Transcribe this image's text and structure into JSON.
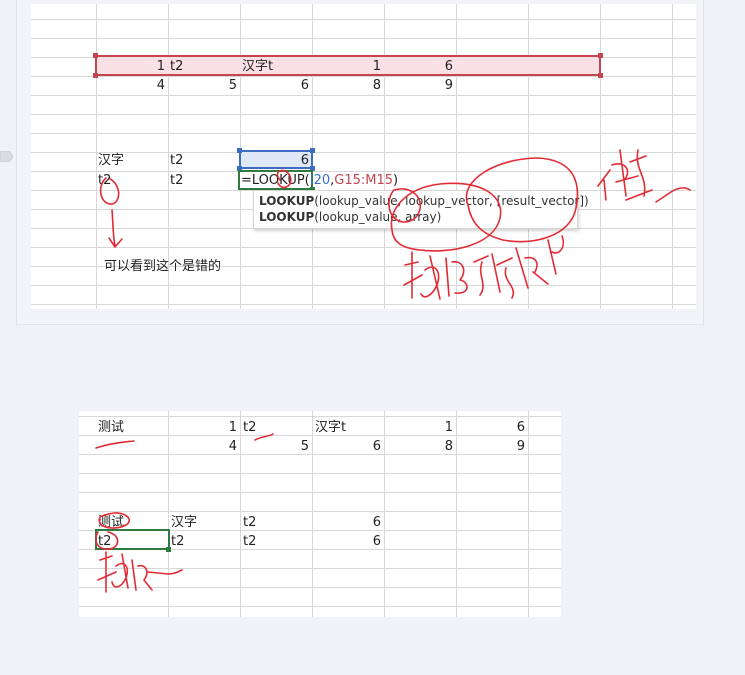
{
  "sheet_top": {
    "row1": {
      "c1": "1",
      "c2": "t2",
      "c3": "汉字t",
      "c4": "1",
      "c5": "6"
    },
    "row2": {
      "c1": "4",
      "c2": "5",
      "c3": "6",
      "c4": "8",
      "c5": "9"
    },
    "row3": {
      "a": "汉字",
      "b": "t2",
      "c": "6"
    },
    "row4": {
      "a": "t2",
      "b": "t2"
    },
    "formula": {
      "prefix": "=LOOKUP(",
      "arg1": "I20",
      "sep": ",",
      "arg2": "G15:M15",
      "suffix": ")"
    },
    "tooltip": {
      "line1": {
        "fn": "LOOKUP",
        "args": "(lookup_value, lookup_vector, [result_vector])"
      },
      "line2": {
        "fn": "LOOKUP",
        "args": "(lookup_value, array)"
      }
    },
    "note": "可以看到这个是错的"
  },
  "sheet_bottom": {
    "row1": {
      "a": "测试",
      "b": "1",
      "c": "t2",
      "d": "汉字t",
      "e": "1",
      "f": "6"
    },
    "row2": {
      "b": "4",
      "c": "5",
      "d": "6",
      "e": "8",
      "f": "9"
    },
    "row3": {
      "a": "测试",
      "b": "汉字",
      "c": "t2",
      "d": "6"
    },
    "row4": {
      "a": "t2",
      "b": "t2",
      "c": "t2",
      "d": "6"
    }
  },
  "colors": {
    "annotation_ink": "#e32b35",
    "selection_red": "#c2454f",
    "selection_blue": "#3c6fc4",
    "active_green": "#2f7a3f"
  }
}
